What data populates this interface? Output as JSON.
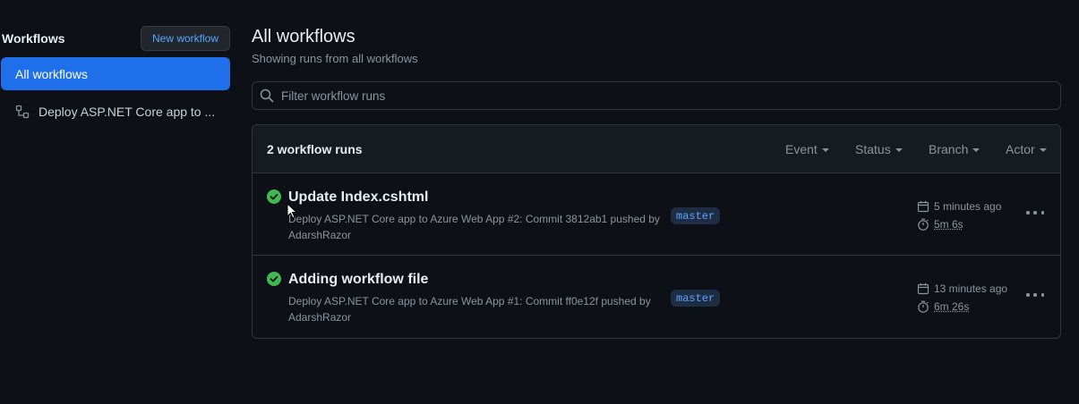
{
  "sidebar": {
    "title": "Workflows",
    "new_workflow_label": "New workflow",
    "items": [
      {
        "label": "All workflows",
        "active": true
      },
      {
        "label": "Deploy ASP.NET Core app to ...",
        "icon": "workflow-icon"
      }
    ]
  },
  "main": {
    "title": "All workflows",
    "subtitle": "Showing runs from  all workflows",
    "filter_placeholder": "Filter workflow runs",
    "runs_count": "2 workflow runs",
    "filters": [
      "Event",
      "Status",
      "Branch",
      "Actor"
    ],
    "runs": [
      {
        "title": "Update Index.cshtml",
        "description": "Deploy ASP.NET Core app to Azure Web App #2: Commit 3812ab1 pushed by AdarshRazor",
        "branch": "master",
        "time": "5 minutes ago",
        "duration": "5m 6s",
        "status": "success"
      },
      {
        "title": "Adding workflow file",
        "description": "Deploy ASP.NET Core app to Azure Web App #1: Commit ff0e12f pushed by AdarshRazor",
        "branch": "master",
        "time": "13 minutes ago",
        "duration": "6m 26s",
        "status": "success"
      }
    ]
  },
  "colors": {
    "background": "#0d1117",
    "accent": "#1f6feb",
    "link": "#58a6ff",
    "success": "#3fb950",
    "muted": "#8b949e"
  }
}
